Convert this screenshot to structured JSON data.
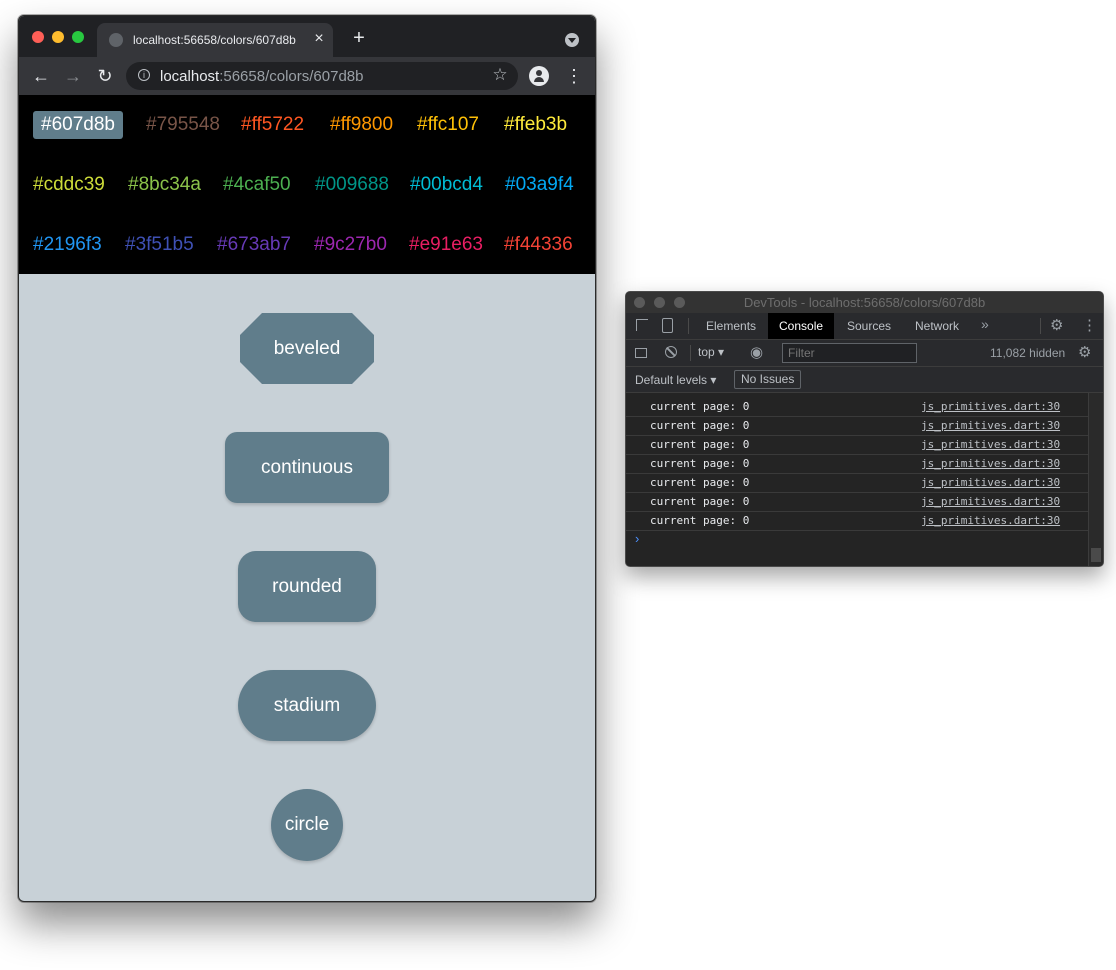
{
  "browser": {
    "tab_title": "localhost:56658/colors/607d8b",
    "tab_close": "×",
    "new_tab": "+",
    "url_host": "localhost",
    "url_rest": ":56658/colors/607d8b"
  },
  "colors": {
    "selected_color": "#607d8b",
    "swatches": [
      {
        "label": "#607d8b",
        "color": "#ffffff",
        "selected": true
      },
      {
        "label": "#795548",
        "color": "#795548"
      },
      {
        "label": "#ff5722",
        "color": "#ff5722"
      },
      {
        "label": "#ff9800",
        "color": "#ff9800"
      },
      {
        "label": "#ffc107",
        "color": "#ffc107"
      },
      {
        "label": "#ffeb3b",
        "color": "#ffeb3b"
      },
      {
        "label": "#cddc39",
        "color": "#cddc39"
      },
      {
        "label": "#8bc34a",
        "color": "#8bc34a"
      },
      {
        "label": "#4caf50",
        "color": "#4caf50"
      },
      {
        "label": "#009688",
        "color": "#009688"
      },
      {
        "label": "#00bcd4",
        "color": "#00bcd4"
      },
      {
        "label": "#03a9f4",
        "color": "#03a9f4"
      },
      {
        "label": "#2196f3",
        "color": "#2196f3"
      },
      {
        "label": "#3f51b5",
        "color": "#3f51b5"
      },
      {
        "label": "#673ab7",
        "color": "#673ab7"
      },
      {
        "label": "#9c27b0",
        "color": "#9c27b0"
      },
      {
        "label": "#e91e63",
        "color": "#e91e63"
      },
      {
        "label": "#f44336",
        "color": "#f44336"
      }
    ]
  },
  "shapes": {
    "beveled": "beveled",
    "continuous": "continuous",
    "rounded": "rounded",
    "stadium": "stadium",
    "circle": "circle"
  },
  "devtools": {
    "title": "DevTools - localhost:56658/colors/607d8b",
    "tabs": [
      "Elements",
      "Console",
      "Sources",
      "Network"
    ],
    "more": "»",
    "context": "top ▾",
    "filter_placeholder": "Filter",
    "hidden_count": "11,082 hidden",
    "levels": "Default levels ▾",
    "issues": "No Issues",
    "prompt": "›",
    "logs": [
      {
        "message": "current page: 0",
        "source": "js_primitives.dart:30"
      },
      {
        "message": "current page: 0",
        "source": "js_primitives.dart:30"
      },
      {
        "message": "current page: 0",
        "source": "js_primitives.dart:30"
      },
      {
        "message": "current page: 0",
        "source": "js_primitives.dart:30"
      },
      {
        "message": "current page: 0",
        "source": "js_primitives.dart:30"
      },
      {
        "message": "current page: 0",
        "source": "js_primitives.dart:30"
      },
      {
        "message": "current page: 0",
        "source": "js_primitives.dart:30"
      }
    ]
  }
}
